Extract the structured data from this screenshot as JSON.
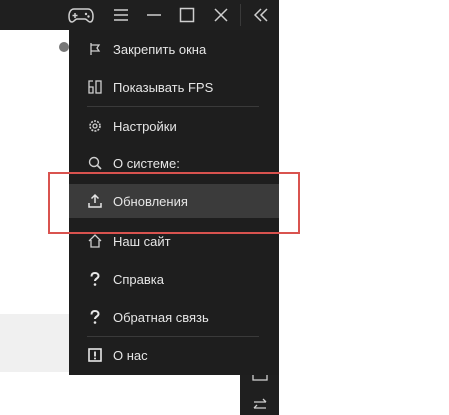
{
  "menu": {
    "items": [
      {
        "label": "Закрепить окна",
        "icon": "pin-icon"
      },
      {
        "label": "Показывать FPS",
        "icon": "fps-icon"
      },
      {
        "label": "Настройки",
        "icon": "gear-icon"
      },
      {
        "label": "О системе:",
        "icon": "search-icon"
      },
      {
        "label": "Обновления",
        "icon": "upload-icon"
      },
      {
        "label": "Наш сайт",
        "icon": "home-icon"
      },
      {
        "label": "Справка",
        "icon": "question-icon"
      },
      {
        "label": "Обратная связь",
        "icon": "question-icon"
      },
      {
        "label": "О нас",
        "icon": "info-icon"
      }
    ],
    "highlighted_item": "Обновления"
  },
  "titlebar": {
    "icons": [
      "gamepad-icon",
      "menu-icon",
      "minimize-icon",
      "maximize-icon",
      "close-icon",
      "collapse-icon"
    ]
  },
  "colors": {
    "menu_bg": "#1e1e1e",
    "highlight_bg": "#3b3b3b",
    "text": "#e6e6e6",
    "annotation": "#d9534f"
  }
}
